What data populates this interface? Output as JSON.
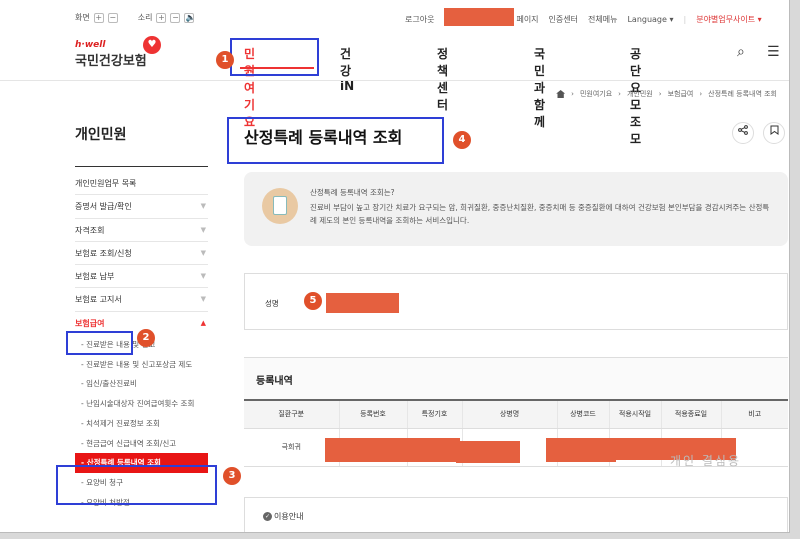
{
  "utility": {
    "screen_label": "화면",
    "sound_label": "소리",
    "zoom_plus": "+",
    "zoom_minus": "−",
    "vol_plus": "+",
    "vol_minus": "−",
    "vol_icon": "🔈",
    "login_label": "로그아웃",
    "mypage_suffix": "페이지",
    "auth_center": "인증센터",
    "full_menu": "전체메뉴",
    "language": "Language",
    "business_site": "분야별업무사이트"
  },
  "logo": {
    "tagline": "h·well",
    "name": "국민건강보험"
  },
  "gnb": {
    "items": [
      "민원여기요",
      "건강iN",
      "정책센터",
      "국민과함께",
      "공단요모조모"
    ]
  },
  "breadcrumb": [
    "민원여기요",
    "개인민원",
    "보험급여",
    "산정특례 등록내역 조회"
  ],
  "sidebar": {
    "title": "개인민원",
    "menu": [
      {
        "label": "개인민원업무 목록",
        "arrow": ""
      },
      {
        "label": "증명서 발급/확인",
        "arrow": "▼"
      },
      {
        "label": "자격조회",
        "arrow": "▼"
      },
      {
        "label": "보험료 조회/신청",
        "arrow": "▼"
      },
      {
        "label": "보험료 납부",
        "arrow": "▼"
      },
      {
        "label": "보험료 고지서",
        "arrow": "▼"
      },
      {
        "label": "보험급여",
        "arrow": "▲"
      }
    ],
    "submenu": [
      "진료받은 내용 및 신고",
      "진료받은 내용 및 신고포상금 제도",
      "임신/출산진료비",
      "난임시술대상자 진여급여횟수 조회",
      "치석제거 진료정보 조회",
      "현금급여 신급내역 조회/신고",
      "산정특례 등록내역 조회",
      "요양비 청구",
      "요양비 처방전"
    ]
  },
  "page": {
    "title": "산정특례 등록내역 조회",
    "share_icon": "⋖",
    "bookmark_icon": "⊡"
  },
  "info": {
    "question": "산정특례 등록내역 조회는?",
    "description": "진료비 부담이 높고 장기간 치료가 요구되는 암, 희귀질환, 중증난치질환, 중증치매 등 중증질환에 대하여 건강보험 본인부담을 경감시켜주는 산정특례 제도의 본인 등록내역을 조회하는 서비스입니다."
  },
  "name_field": {
    "label": "성명"
  },
  "registration": {
    "heading": "등록내역",
    "columns": [
      "질환구분",
      "등록번호",
      "특정기호",
      "상병명",
      "상병코드",
      "적용시작일",
      "적용종료일",
      "비고"
    ],
    "rows": [
      [
        "극희귀",
        "",
        "",
        "",
        "",
        "",
        "",
        ""
      ]
    ]
  },
  "usage": {
    "label": "이용안내"
  },
  "watermark": "개인 결심용",
  "annotations": [
    "1",
    "2",
    "3",
    "4",
    "5"
  ],
  "colors": {
    "accent": "#e33333",
    "annotation_blue": "#2e3fd6",
    "annotation_badge": "#e0502a",
    "redaction": "#e5603f"
  }
}
